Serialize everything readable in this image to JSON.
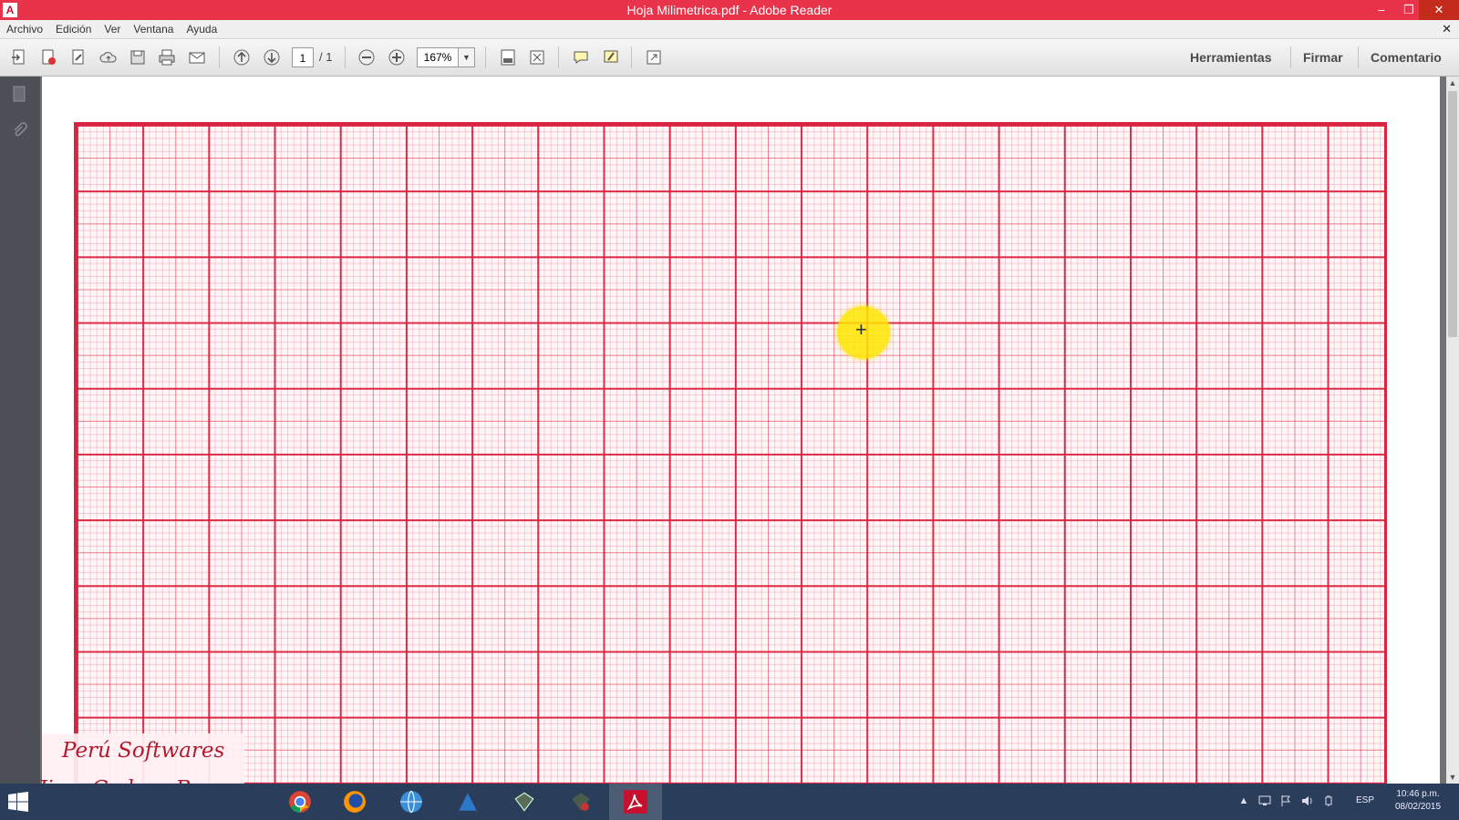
{
  "window": {
    "title": "Hoja Milimetrica.pdf - Adobe Reader",
    "controls": {
      "minimize": "–",
      "restore": "❐",
      "close": "✕"
    }
  },
  "menu": {
    "items": [
      "Archivo",
      "Edición",
      "Ver",
      "Ventana",
      "Ayuda"
    ],
    "doc_close": "✕"
  },
  "toolbar": {
    "current_page": "1",
    "total_pages": "/ 1",
    "zoom": "167%",
    "zoom_dropdown": "▼",
    "panels": [
      "Herramientas",
      "Firmar",
      "Comentario"
    ]
  },
  "scrollbar": {
    "up": "▲",
    "down": "▼"
  },
  "watermark": {
    "line1": "Perú Softwares",
    "line2": "Jimy Cadera Romero"
  },
  "taskbar": {
    "language": "ESP",
    "time": "10:46 p.m.",
    "date": "08/02/2015",
    "tray_up": "▲"
  },
  "colors": {
    "title_bar": "#e8334b",
    "grid_line": "#d8243f",
    "taskbar": "#2a3d5a",
    "highlight": "#ffe600"
  }
}
